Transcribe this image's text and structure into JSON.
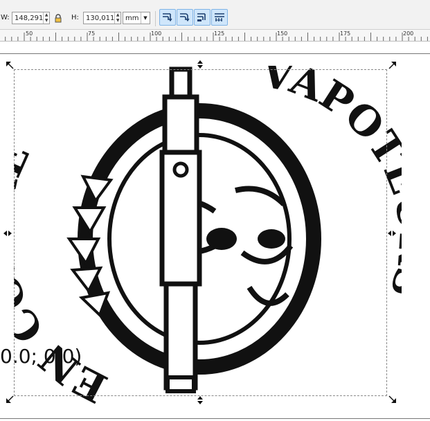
{
  "toolbar": {
    "width_label": "W:",
    "width_value": "148,291",
    "height_label": "H:",
    "height_value": "130,011",
    "unit": "mm"
  },
  "ruler": {
    "ticks": [
      "50",
      "75",
      "100",
      "125",
      "150",
      "175",
      "200"
    ]
  },
  "canvas": {
    "coordinate_text": "0.0; 0.0)"
  },
  "artwork": {
    "left_arc_text": "EN COLERE",
    "right_arc_text": "VAPOTEURS"
  },
  "colors": {
    "toolbar_bg": "#f2f2f2",
    "toggle_active_bg": "#cfe6fb",
    "toggle_active_border": "#7fb3e6",
    "artwork": "#111111"
  }
}
